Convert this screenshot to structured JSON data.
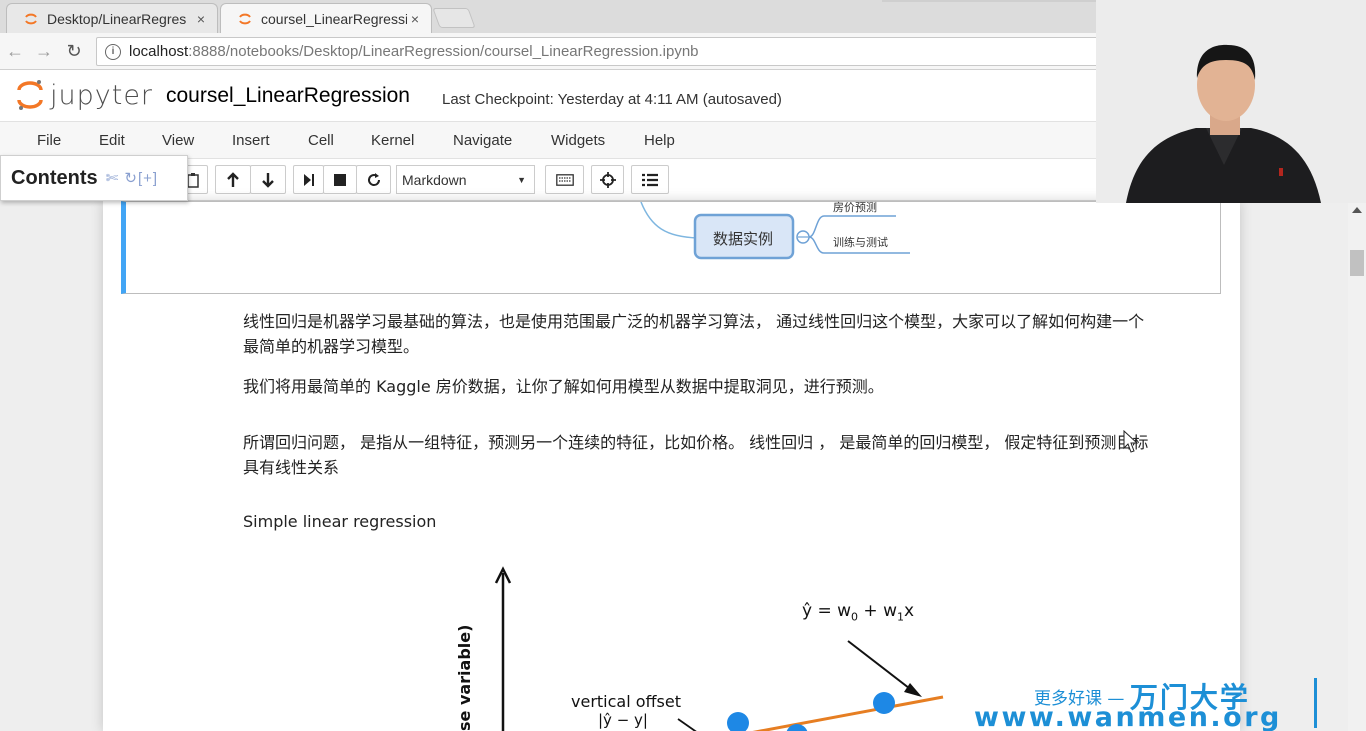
{
  "browser": {
    "tabs": [
      {
        "title": "Desktop/LinearRegres",
        "close": "×"
      },
      {
        "title": "coursel_LinearRegressi",
        "close": "×"
      }
    ],
    "url_host": "localhost",
    "url_path": ":8888/notebooks/Desktop/LinearRegression/coursel_LinearRegression.ipynb"
  },
  "jupyter": {
    "logo_text": "jupyter",
    "notebook_name": "coursel_LinearRegression",
    "checkpoint": "Last Checkpoint: Yesterday at 4:11 AM (autosaved)",
    "menu": [
      "File",
      "Edit",
      "View",
      "Insert",
      "Cell",
      "Kernel",
      "Navigate",
      "Widgets",
      "Help"
    ],
    "cell_type": "Markdown",
    "contents_label": "Contents",
    "contents_tools": "✄ ↻[+]"
  },
  "mindmap": {
    "node": "数据实例",
    "branches": [
      "房价预测",
      "训练与测试"
    ]
  },
  "content": {
    "p1_line1": "线性回归是机器学习最基础的算法，也是使用范围最广泛的机器学习算法， 通过线性回归这个模型，大家可以了解如何构建一个",
    "p1_line2": "最简单的机器学习模型。",
    "p2": "我们将用最简单的 Kaggle 房价数据，让你了解如何用模型从数据中提取洞见，进行预测。",
    "p3_line1": "所谓回归问题， 是指从一组特征，预测另一个连续的特征，比如价格。 线性回归 ， 是最简单的回归模型， 假定特征到预测目标",
    "p3_line2": "具有线性关系",
    "p4": "Simple linear regression"
  },
  "figure": {
    "equation_main": "ŷ = w",
    "equation_sub0": "0",
    "equation_plus": " + w",
    "equation_sub1": "1",
    "equation_x": "x",
    "offset_label": "vertical offset",
    "offset_formula": "|ŷ − y|",
    "y_axis_label": "se variable)",
    "colors": {
      "points": "#1e88e5",
      "line": "#e67e22"
    }
  },
  "watermark": {
    "top_text": "更多好课 — ",
    "brand": "万门大学",
    "url": "www.wanmen.org"
  },
  "colors": {
    "accent": "#42a5f5",
    "jupyter_orange": "#f37726",
    "watermark": "#1d8fd6"
  }
}
